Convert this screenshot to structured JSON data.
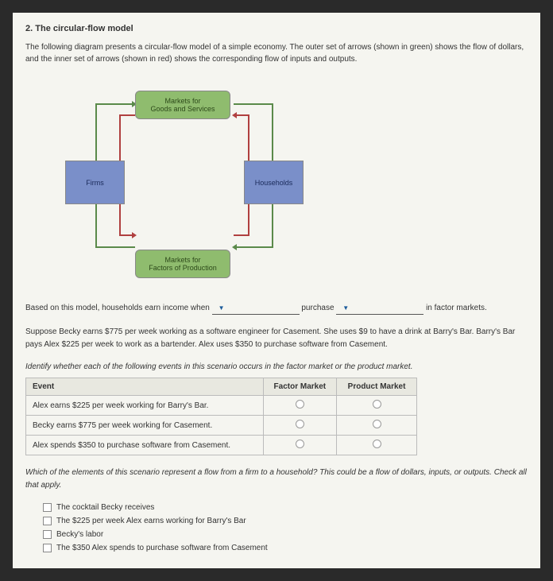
{
  "question": {
    "number": "2.",
    "title": "The circular-flow model",
    "intro": "The following diagram presents a circular-flow model of a simple economy. The outer set of arrows (shown in green) shows the flow of dollars, and the inner set of arrows (shown in red) shows the corresponding flow of inputs and outputs."
  },
  "diagram": {
    "top": "Markets for\nGoods and Services",
    "bottom": "Markets for\nFactors of Production",
    "left": "Firms",
    "right": "Households"
  },
  "stem": {
    "prefix": "Based on this model, households earn income when",
    "dd1_placeholder": "",
    "mid": "purchase",
    "dd2_placeholder": "",
    "suffix": "in factor markets."
  },
  "scenario": "Suppose Becky earns $775 per week working as a software engineer for Casement. She uses $9 to have a drink at Barry's Bar. Barry's Bar pays Alex $225 per week to work as a bartender. Alex uses $350 to purchase software from Casement.",
  "table_instruction": "Identify whether each of the following events in this scenario occurs in the factor market or the product market.",
  "table": {
    "headers": [
      "Event",
      "Factor Market",
      "Product Market"
    ],
    "rows": [
      "Alex earns $225 per week working for Barry's Bar.",
      "Becky earns $775 per week working for Casement.",
      "Alex spends $350 to purchase software from Casement."
    ]
  },
  "checklist_instruction": "Which of the elements of this scenario represent a flow from a firm to a household? This could be a flow of dollars, inputs, or outputs. Check all that apply.",
  "checklist": [
    "The cocktail Becky receives",
    "The $225 per week Alex earns working for Barry's Bar",
    "Becky's labor",
    "The $350 Alex spends to purchase software from Casement"
  ]
}
